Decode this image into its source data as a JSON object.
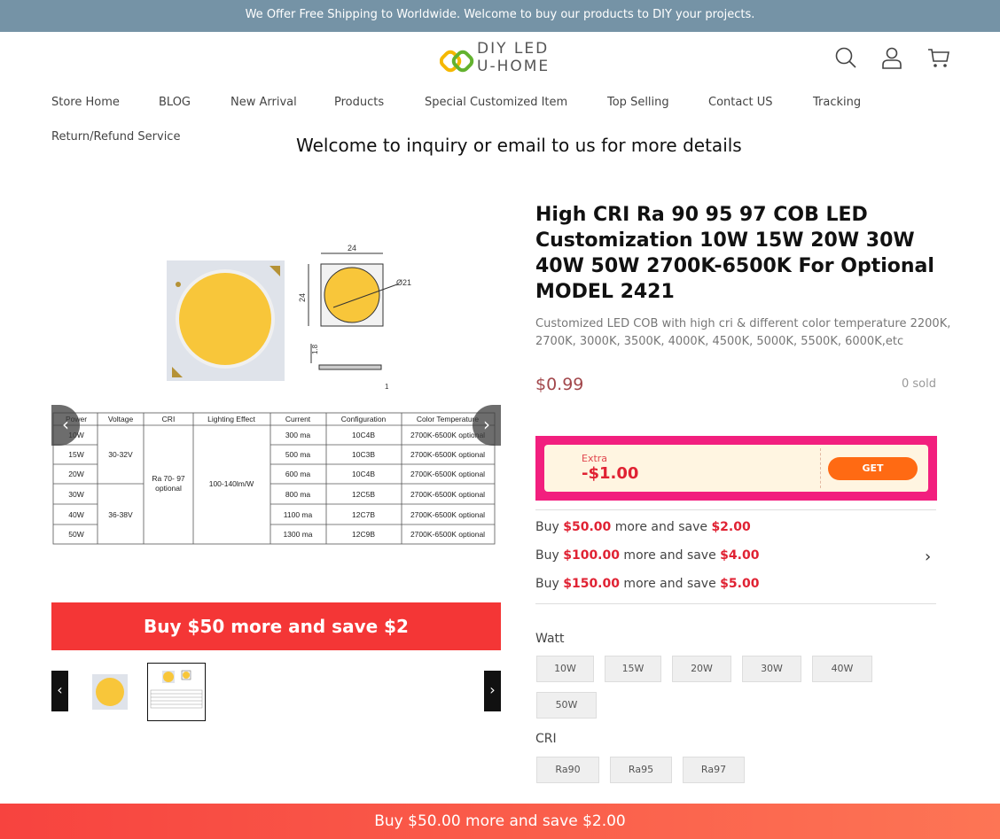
{
  "announcement": "We Offer Free Shipping to Worldwide. Welcome to buy our products to DIY your projects.",
  "logo": {
    "line1": "DIY LED",
    "line2": "U-HOME"
  },
  "header_icons": [
    "search-icon",
    "user-icon",
    "cart-icon"
  ],
  "nav": {
    "items": [
      "Store Home",
      "BLOG",
      "New Arrival",
      "Products",
      "Special Customized Item",
      "Top Selling",
      "Contact US",
      "Tracking",
      "Return/Refund Service"
    ]
  },
  "welcome": "Welcome to inquiry or email to us for more details",
  "spec_table": {
    "headers": [
      "Power",
      "Voltage",
      "CRI",
      "Lighting Effect",
      "Current",
      "Configuration",
      "Color Temperature"
    ],
    "powers": [
      "10W",
      "15W",
      "20W",
      "30W",
      "40W",
      "50W"
    ],
    "voltages": [
      "30-32V",
      "36-38V"
    ],
    "cri": [
      "Ra 70- 97",
      "optional"
    ],
    "lighting_effect": "100-140lm/W",
    "currents": [
      "300 ma",
      "500 ma",
      "600 ma",
      "800 ma",
      "1100 ma",
      "1300 ma"
    ],
    "configurations": [
      "10C4B",
      "10C3B",
      "10C4B",
      "12C5B",
      "12C7B",
      "12C9B"
    ],
    "color_temperature": "2700K-6500K optional",
    "dims": {
      "width": "24",
      "height": "24",
      "diameter": "Ø21",
      "thickness": "1.8",
      "edge": "1"
    }
  },
  "promo_bar": "Buy $50 more and save $2",
  "product": {
    "title": "High CRI Ra 90 95 97 COB LED Customization 10W 15W 20W 30W 40W 50W 2700K-6500K For Optional MODEL 2421",
    "subtitle": "Customized LED COB with high cri & different color temperature 2200K, 2700K, 3000K, 3500K, 4000K, 4500K, 5000K, 5500K, 6000K,etc",
    "price": "$0.99",
    "sold": "0 sold"
  },
  "coupon": {
    "extra": "Extra",
    "amount": "-$1.00",
    "get": "GET"
  },
  "savings": [
    {
      "pre": "Buy ",
      "amount": "$50.00",
      "mid": " more and save ",
      "save": "$2.00"
    },
    {
      "pre": "Buy ",
      "amount": "$100.00",
      "mid": " more and save ",
      "save": "$4.00"
    },
    {
      "pre": "Buy ",
      "amount": "$150.00",
      "mid": " more and save ",
      "save": "$5.00"
    }
  ],
  "options": {
    "watt_label": "Watt",
    "watt": [
      "10W",
      "15W",
      "20W",
      "30W",
      "40W",
      "50W"
    ],
    "cri_label": "CRI",
    "cri": [
      "Ra90",
      "Ra95",
      "Ra97"
    ]
  },
  "bottom_bar": {
    "pre": "Buy ",
    "amount": "$50.00",
    "mid": " more and save ",
    "save": "$2.00"
  },
  "colors": {
    "announce": "#7593a6",
    "price": "#a2474b",
    "promo": "#f43636",
    "coupon_frame": "#f21f7e",
    "get_button": "#ff6a13",
    "highlight": "#e02233"
  }
}
